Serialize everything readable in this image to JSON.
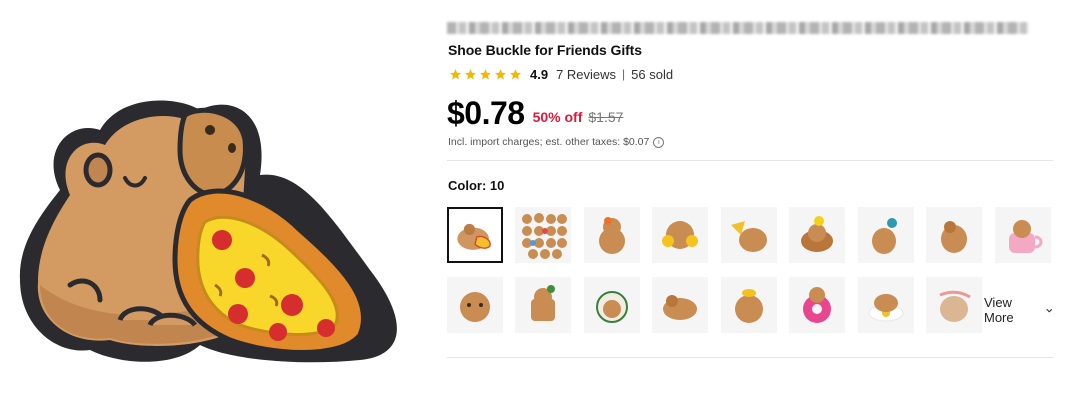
{
  "product": {
    "title": "Shoe Buckle for Friends Gifts",
    "rating": "4.9",
    "reviews": "7 Reviews",
    "separator": "|",
    "sold": "56 sold",
    "stars": 5,
    "star_color": "#f5b800"
  },
  "pricing": {
    "price": "$0.78",
    "discount": "50% off",
    "original": "$1.57",
    "tax_note": "Incl. import charges; est. other taxes: $0.07",
    "discount_color": "#e0193a"
  },
  "variants": {
    "label": "Color: 10",
    "view_more": "View More",
    "selected_index": 0
  }
}
